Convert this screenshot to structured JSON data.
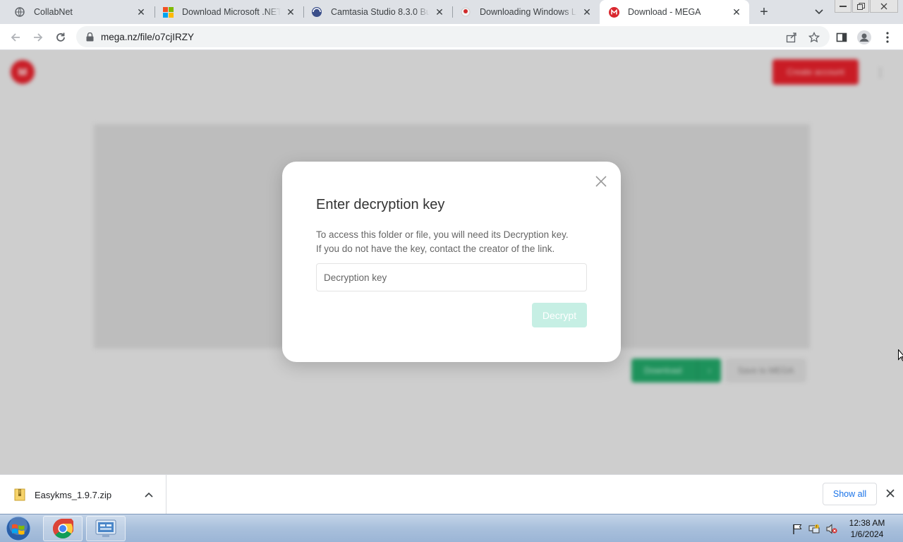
{
  "tabs": [
    {
      "title": "CollabNet",
      "favicon": "globe-icon",
      "active": false
    },
    {
      "title": "Download Microsoft .NET Framework",
      "favicon": "microsoft-logo-icon",
      "active": false
    },
    {
      "title": "Camtasia Studio 8.3.0 Build",
      "favicon": "camtasia-icon",
      "active": false
    },
    {
      "title": "Downloading Windows Loader",
      "favicon": "loader-icon",
      "active": false
    },
    {
      "title": "Download - MEGA",
      "favicon": "mega-icon",
      "active": true
    }
  ],
  "address_bar": {
    "url": "mega.nz/file/o7cjIRZY"
  },
  "page": {
    "logo_text": "M",
    "create_account_label": "Create account",
    "download_label": "Download",
    "save_to_mega_label": "Save to MEGA"
  },
  "dialog": {
    "title": "Enter decryption key",
    "description_line1": "To access this folder or file, you will need its Decryption key.",
    "description_line2": "If you do not have the key, contact the creator of the link.",
    "input_placeholder": "Decryption key",
    "input_value": "",
    "decrypt_label": "Decrypt"
  },
  "download_shelf": {
    "file_name": "Easykms_1.9.7.zip",
    "show_all_label": "Show all"
  },
  "taskbar": {
    "time": "12:38 AM",
    "date": "1/6/2024"
  },
  "colors": {
    "mega_red": "#e0202a",
    "mega_green": "#21a366",
    "decrypt_disabled": "#c6efe4",
    "link_blue": "#1a73e8"
  }
}
